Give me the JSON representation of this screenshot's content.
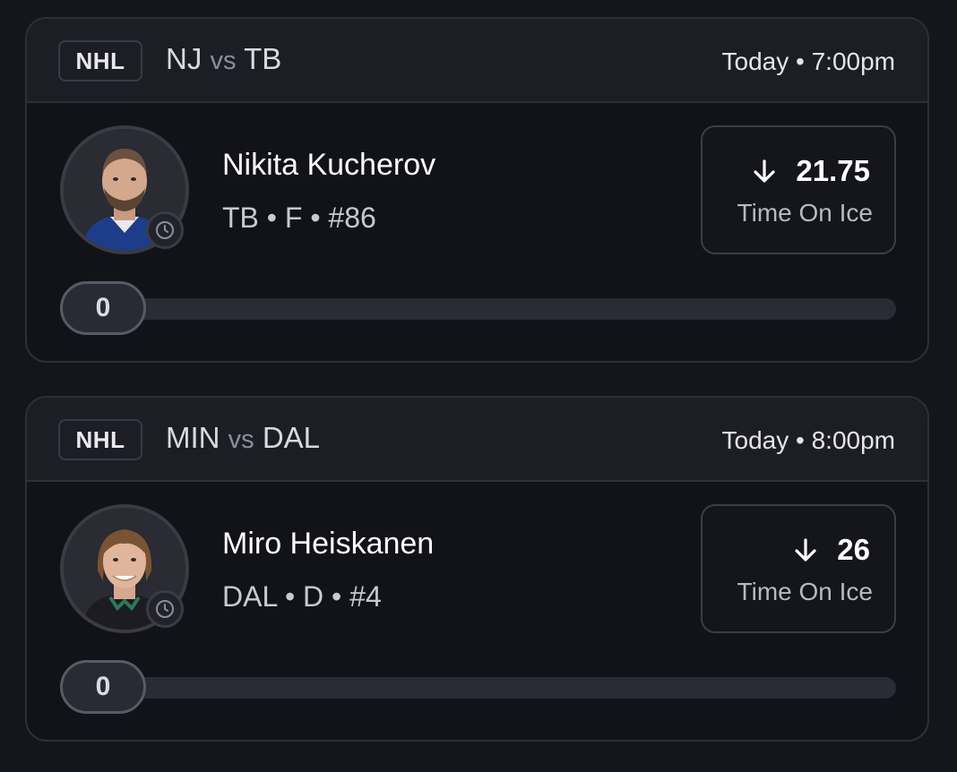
{
  "cards": [
    {
      "league": "NHL",
      "home": "NJ",
      "vs": "vs",
      "away": "TB",
      "time": "Today • 7:00pm",
      "player": {
        "name": "Nikita Kucherov",
        "meta": "TB • F • #86"
      },
      "prop": {
        "direction_icon": "arrow-down-icon",
        "value": "21.75",
        "label": "Time On Ice"
      },
      "progress": {
        "value": "0",
        "fraction": 0
      }
    },
    {
      "league": "NHL",
      "home": "MIN",
      "vs": "vs",
      "away": "DAL",
      "time": "Today • 8:00pm",
      "player": {
        "name": "Miro Heiskanen",
        "meta": "DAL • D • #4"
      },
      "prop": {
        "direction_icon": "arrow-down-icon",
        "value": "26",
        "label": "Time On Ice"
      },
      "progress": {
        "value": "0",
        "fraction": 0
      }
    }
  ],
  "colors": {
    "background": "#15151d",
    "card": "#121219",
    "header": "#1d1d25",
    "border": "#2f2f38",
    "track": "#2b2b35"
  }
}
